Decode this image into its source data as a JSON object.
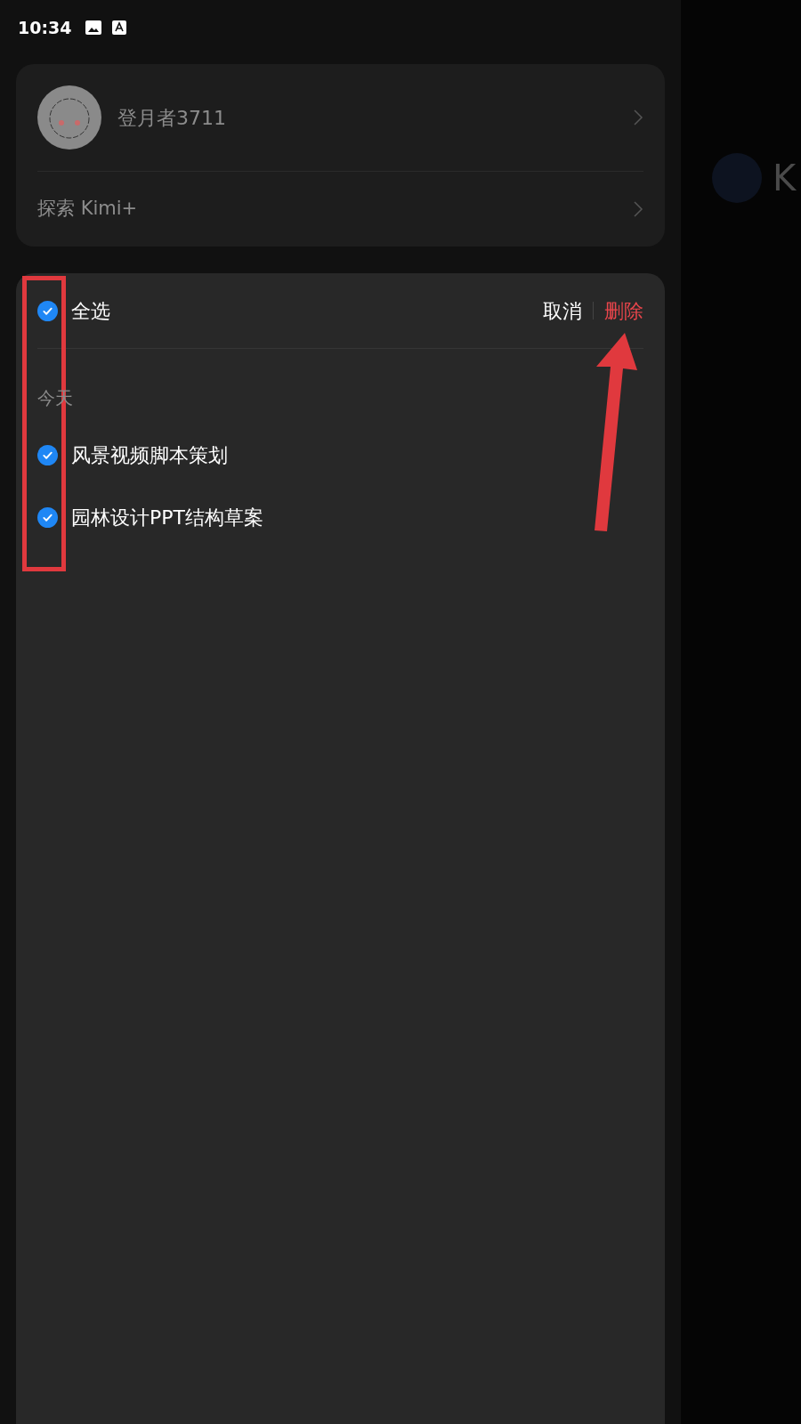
{
  "status_bar": {
    "time": "10:34"
  },
  "profile": {
    "name": "登月者3711"
  },
  "explore": {
    "label": "探索 Kimi+"
  },
  "selection": {
    "select_all": {
      "label": "全选",
      "checked": true
    },
    "cancel": "取消",
    "delete": "删除"
  },
  "sections": [
    {
      "label": "今天",
      "items": [
        {
          "title": "风景视频脚本策划",
          "checked": true
        },
        {
          "title": "园林设计PPT结构草案",
          "checked": true
        }
      ]
    }
  ],
  "background": {
    "title": "K"
  }
}
